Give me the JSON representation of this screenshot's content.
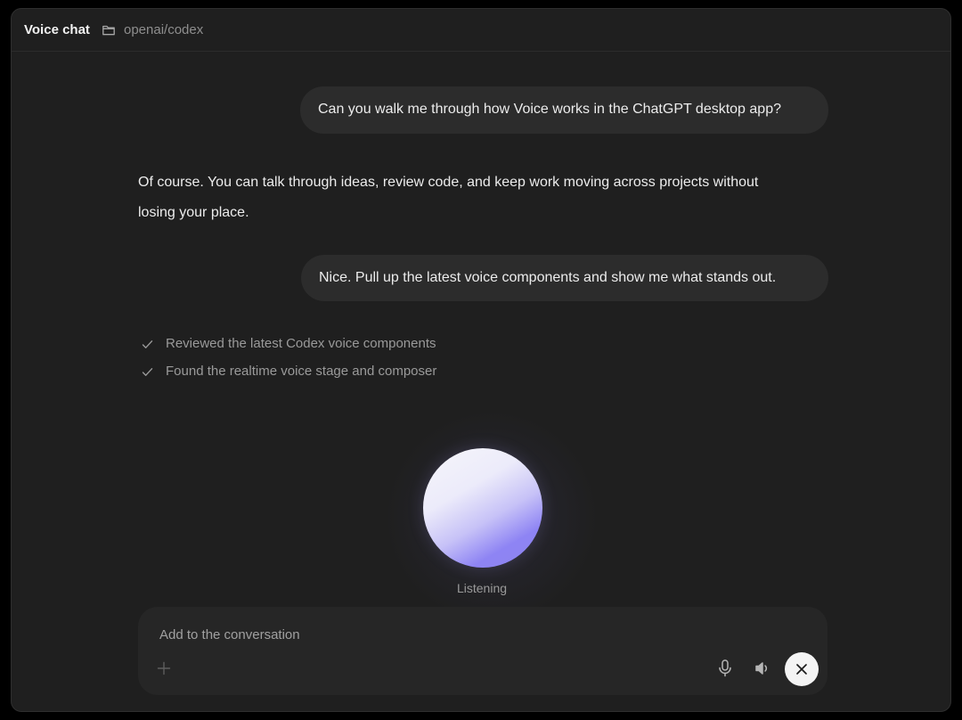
{
  "header": {
    "title": "Voice chat",
    "repo": "openai/codex"
  },
  "messages": {
    "user_1": "Can you walk me through how Voice works in the ChatGPT desktop app?",
    "assistant_1": "Of course. You can talk through ideas, review code, and keep work moving across projects without losing your place.",
    "user_2": "Nice. Pull up the latest voice components and show me what stands out."
  },
  "steps": [
    {
      "label": "Reviewed the latest Codex voice components",
      "icon": "check-icon"
    },
    {
      "label": "Found the realtime voice stage and composer",
      "icon": "check-icon"
    }
  ],
  "voice": {
    "status": "Listening"
  },
  "composer": {
    "placeholder": "Add to the conversation",
    "value": ""
  },
  "icons": {
    "folder": "folder-icon",
    "plus": "plus-icon",
    "mic": "microphone-icon",
    "speaker": "speaker-icon",
    "close": "close-icon"
  },
  "colors": {
    "background": "#1f1f1f",
    "bubble": "#2c2c2c",
    "composer": "#262626",
    "orb_accent": "#8e84f4"
  }
}
